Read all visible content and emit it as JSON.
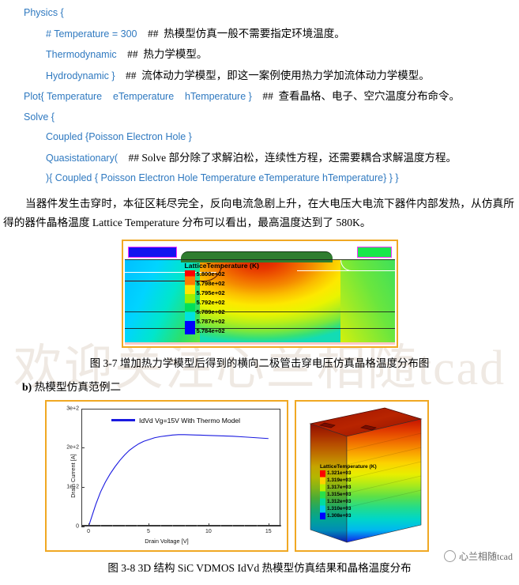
{
  "code": {
    "lines": [
      {
        "indent": 0,
        "code": "Physics {",
        "comment": ""
      },
      {
        "indent": 1,
        "code": "# Temperature = 300",
        "comment": "##  热模型仿真一般不需要指定环境温度。"
      },
      {
        "indent": 1,
        "code": "Thermodynamic",
        "comment": "##  热力学模型。"
      },
      {
        "indent": 1,
        "code": "Hydrodynamic }",
        "comment": "##  流体动力学模型，即这一案例使用热力学加流体动力学模型。"
      },
      {
        "indent": 0,
        "code": "Plot{ Temperature    eTemperature    hTemperature }",
        "comment": "##  查看晶格、电子、空穴温度分布命令。"
      },
      {
        "indent": 0,
        "code": "Solve {",
        "comment": ""
      },
      {
        "indent": 1,
        "code": "Coupled {Poisson Electron Hole }",
        "comment": ""
      },
      {
        "indent": 1,
        "code": "Quasistationary(",
        "comment": "## Solve 部分除了求解泊松，连续性方程，还需要耦合求解温度方程。"
      },
      {
        "indent": 1,
        "code": "){ Coupled { Poisson Electron Hole Temperature eTemperature hTemperature} } }",
        "comment": ""
      }
    ]
  },
  "paragraph": {
    "text": "当器件发生击穿时，本征区耗尽完全，反向电流急剧上升，在大电压大电流下器件内部发热，从仿真所得的器件晶格温度 Lattice Temperature 分布可以看出，最高温度达到了 580K。"
  },
  "figure1": {
    "legend_title": "LatticeTemperature (K)",
    "legend_values": [
      "5.800e+02",
      "5.798e+02",
      "5.795e+02",
      "5.792e+02",
      "5.789e+02",
      "5.787e+02",
      "5.784e+02"
    ],
    "caption": "图 3-7  增加热力学模型后得到的横向二极管击穿电压仿真晶格温度分布图"
  },
  "section_b": {
    "marker": "b)",
    "title": "热模型仿真范例二"
  },
  "watermark": {
    "text": "欢迎关注心兰相随tcad"
  },
  "chart_data": {
    "type": "line",
    "title": "",
    "xlabel": "Drain Voltage [V]",
    "ylabel": "Drain Current [A]",
    "xlim": [
      -0.6,
      16
    ],
    "ylim": [
      0,
      300
    ],
    "xticks": [
      0,
      5,
      10,
      15
    ],
    "xticklabels": [
      "0",
      "5",
      "10",
      "15"
    ],
    "yticks": [
      0,
      100,
      200,
      300
    ],
    "yticklabels": [
      "0",
      "1e+2",
      "2e+2",
      "3e+2"
    ],
    "grid": false,
    "legend_position": "top-left",
    "series": [
      {
        "name": "IdVd Vg=15V With Thermo Model",
        "color": "#1a1ae0",
        "x": [
          0,
          0.3,
          0.6,
          1.0,
          1.4,
          1.8,
          2.2,
          2.6,
          3.0,
          3.4,
          3.8,
          4.2,
          4.6,
          5.0,
          5.5,
          6.0,
          6.5,
          7.0,
          7.5,
          8.0,
          9.0,
          10.0,
          11.0,
          12.0,
          13.0,
          14.0,
          15.0
        ],
        "y": [
          0,
          28,
          56,
          88,
          113,
          134,
          152,
          168,
          182,
          194,
          203,
          211,
          217,
          221,
          226,
          229,
          231,
          233,
          234,
          234,
          233,
          232,
          231,
          230,
          228,
          226,
          224
        ]
      }
    ]
  },
  "figure2": {
    "legend_title": "LatticeTemperature (K)",
    "legend_values": [
      "1.321e+03",
      "1.319e+03",
      "1.317e+03",
      "1.315e+03",
      "1.312e+03",
      "1.310e+03",
      "1.308e+03"
    ],
    "caption": "图 3-8 3D 结构 SiC VDMOS IdVd 热模型仿真结果和晶格温度分布"
  },
  "footer": {
    "brand": "心兰相随tcad"
  }
}
